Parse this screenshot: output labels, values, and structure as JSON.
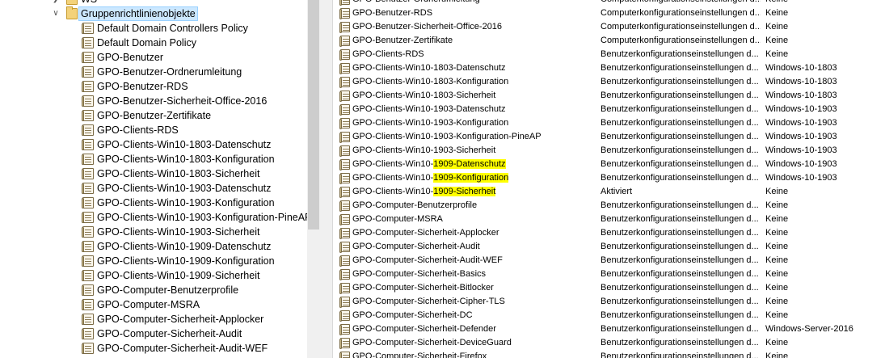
{
  "tree": {
    "partial_top_label": "WS",
    "root": {
      "label": "Gruppenrichtlinienobjekte",
      "expanded": true,
      "selected": true
    },
    "items": [
      "Default Domain Controllers Policy",
      "Default Domain Policy",
      "GPO-Benutzer",
      "GPO-Benutzer-Ordnerumleitung",
      "GPO-Benutzer-RDS",
      "GPO-Benutzer-Sicherheit-Office-2016",
      "GPO-Benutzer-Zertifikate",
      "GPO-Clients-RDS",
      "GPO-Clients-Win10-1803-Datenschutz",
      "GPO-Clients-Win10-1803-Konfiguration",
      "GPO-Clients-Win10-1803-Sicherheit",
      "GPO-Clients-Win10-1903-Datenschutz",
      "GPO-Clients-Win10-1903-Konfiguration",
      "GPO-Clients-Win10-1903-Konfiguration-PineAP",
      "GPO-Clients-Win10-1903-Sicherheit",
      "GPO-Clients-Win10-1909-Datenschutz",
      "GPO-Clients-Win10-1909-Konfiguration",
      "GPO-Clients-Win10-1909-Sicherheit",
      "GPO-Computer-Benutzerprofile",
      "GPO-Computer-MSRA",
      "GPO-Computer-Sicherheit-Applocker",
      "GPO-Computer-Sicherheit-Audit",
      "GPO-Computer-Sicherheit-Audit-WEF"
    ]
  },
  "list": {
    "highlight_color": "#ffff00",
    "rows": [
      {
        "name": "GPO-Benutzer-Ordnerumleitung",
        "status": "Computerkonfigurationseinstellungen d...",
        "wmi": "Keine"
      },
      {
        "name": "GPO-Benutzer-RDS",
        "status": "Computerkonfigurationseinstellungen d...",
        "wmi": "Keine"
      },
      {
        "name": "GPO-Benutzer-Sicherheit-Office-2016",
        "status": "Computerkonfigurationseinstellungen d...",
        "wmi": "Keine"
      },
      {
        "name": "GPO-Benutzer-Zertifikate",
        "status": "Computerkonfigurationseinstellungen d...",
        "wmi": "Keine"
      },
      {
        "name": "GPO-Clients-RDS",
        "status": "Benutzerkonfigurationseinstellungen d...",
        "wmi": "Keine"
      },
      {
        "name": "GPO-Clients-Win10-1803-Datenschutz",
        "status": "Benutzerkonfigurationseinstellungen d...",
        "wmi": "Windows-10-1803"
      },
      {
        "name": "GPO-Clients-Win10-1803-Konfiguration",
        "status": "Benutzerkonfigurationseinstellungen d...",
        "wmi": "Windows-10-1803"
      },
      {
        "name": "GPO-Clients-Win10-1803-Sicherheit",
        "status": "Benutzerkonfigurationseinstellungen d...",
        "wmi": "Windows-10-1803"
      },
      {
        "name": "GPO-Clients-Win10-1903-Datenschutz",
        "status": "Benutzerkonfigurationseinstellungen d...",
        "wmi": "Windows-10-1903"
      },
      {
        "name": "GPO-Clients-Win10-1903-Konfiguration",
        "status": "Benutzerkonfigurationseinstellungen d...",
        "wmi": "Windows-10-1903"
      },
      {
        "name": "GPO-Clients-Win10-1903-Konfiguration-PineAP",
        "status": "Benutzerkonfigurationseinstellungen d...",
        "wmi": "Windows-10-1903"
      },
      {
        "name": "GPO-Clients-Win10-1903-Sicherheit",
        "status": "Benutzerkonfigurationseinstellungen d...",
        "wmi": "Windows-10-1903"
      },
      {
        "name": "GPO-Clients-Win10-1909-Datenschutz",
        "name_prefix": "GPO-Clients-Win10-",
        "name_highlight": "1909-Datenschutz",
        "status": "Benutzerkonfigurationseinstellungen d...",
        "wmi": "Windows-10-1903"
      },
      {
        "name": "GPO-Clients-Win10-1909-Konfiguration",
        "name_prefix": "GPO-Clients-Win10-",
        "name_highlight": "1909-Konfiguration",
        "status": "Benutzerkonfigurationseinstellungen d...",
        "wmi": "Windows-10-1903"
      },
      {
        "name": "GPO-Clients-Win10-1909-Sicherheit",
        "name_prefix": "GPO-Clients-Win10-",
        "name_highlight": "1909-Sicherheit",
        "status": "Aktiviert",
        "wmi": "Keine"
      },
      {
        "name": "GPO-Computer-Benutzerprofile",
        "status": "Benutzerkonfigurationseinstellungen d...",
        "wmi": "Keine"
      },
      {
        "name": "GPO-Computer-MSRA",
        "status": "Benutzerkonfigurationseinstellungen d...",
        "wmi": "Keine"
      },
      {
        "name": "GPO-Computer-Sicherheit-Applocker",
        "status": "Benutzerkonfigurationseinstellungen d...",
        "wmi": "Keine"
      },
      {
        "name": "GPO-Computer-Sicherheit-Audit",
        "status": "Benutzerkonfigurationseinstellungen d...",
        "wmi": "Keine"
      },
      {
        "name": "GPO-Computer-Sicherheit-Audit-WEF",
        "status": "Benutzerkonfigurationseinstellungen d...",
        "wmi": "Keine"
      },
      {
        "name": "GPO-Computer-Sicherheit-Basics",
        "status": "Benutzerkonfigurationseinstellungen d...",
        "wmi": "Keine"
      },
      {
        "name": "GPO-Computer-Sicherheit-Bitlocker",
        "status": "Benutzerkonfigurationseinstellungen d...",
        "wmi": "Keine"
      },
      {
        "name": "GPO-Computer-Sicherheit-Cipher-TLS",
        "status": "Benutzerkonfigurationseinstellungen d...",
        "wmi": "Keine"
      },
      {
        "name": "GPO-Computer-Sicherheit-DC",
        "status": "Benutzerkonfigurationseinstellungen d...",
        "wmi": "Keine"
      },
      {
        "name": "GPO-Computer-Sicherheit-Defender",
        "status": "Benutzerkonfigurationseinstellungen d...",
        "wmi": "Windows-Server-2016"
      },
      {
        "name": "GPO-Computer-Sicherheit-DeviceGuard",
        "status": "Benutzerkonfigurationseinstellungen d...",
        "wmi": "Keine"
      },
      {
        "name": "GPO-Computer-Sicherheit-Firefox",
        "status": "Benutzerkonfigurationseinstellungen d...",
        "wmi": "Keine"
      }
    ]
  }
}
